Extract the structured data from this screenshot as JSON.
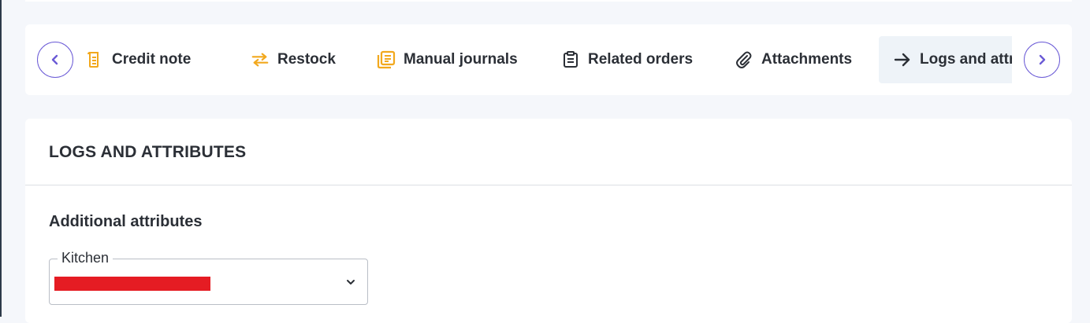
{
  "colors": {
    "accent": "#6b5bd6",
    "tab_icon_orange": "#f2a81d",
    "text": "#2b2f36",
    "active_tab_bg": "#eef3f8",
    "redaction": "#e51c23"
  },
  "tabs_bar": {
    "prev_icon": "chevron-left-icon",
    "next_icon": "chevron-right-icon",
    "tabs": [
      {
        "label": "Credit note",
        "icon": "credit-note-icon",
        "active": false
      },
      {
        "label": "Restock",
        "icon": "swap-arrows-icon",
        "active": false
      },
      {
        "label": "Manual journals",
        "icon": "journal-icon",
        "active": false
      },
      {
        "label": "Related orders",
        "icon": "clipboard-icon",
        "active": false
      },
      {
        "label": "Attachments",
        "icon": "paperclip-icon",
        "active": false
      },
      {
        "label": "Logs and attributes",
        "icon": "arrow-right-icon",
        "active": true
      }
    ]
  },
  "section": {
    "title": "LOGS AND ATTRIBUTES",
    "subtitle": "Additional attributes",
    "kitchen_field": {
      "label": "Kitchen",
      "value": "",
      "icon": "chevron-down-icon"
    }
  }
}
